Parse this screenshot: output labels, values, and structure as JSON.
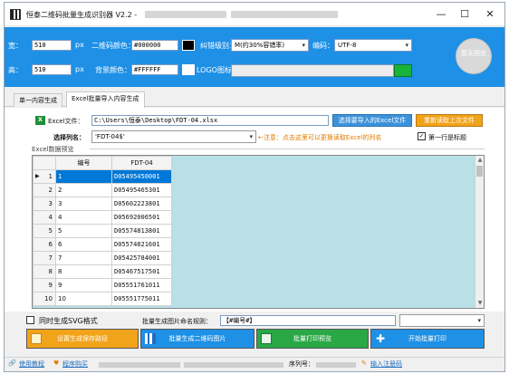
{
  "window": {
    "title": "恒泰二维码批量生成识别器 V2.2 - ",
    "controls": {
      "minimize": "—",
      "maximize": "☐",
      "close": "✕"
    }
  },
  "settings": {
    "width_label": "宽：",
    "width_value": "510",
    "width_unit": "px",
    "height_label": "高：",
    "height_value": "510",
    "height_unit": "px",
    "qr_color_label": "二维码颜色：",
    "qr_color_value": "#000000",
    "qr_color_hex": "#000000",
    "bg_color_label": "背景颜色：",
    "bg_color_value": "#FFFFFF",
    "bg_color_hex": "#FFFFFF",
    "error_level_label": "纠错级别：",
    "error_level_value": "M(约30%容错率)",
    "encoding_label": "编码：",
    "encoding_value": "UTF-8",
    "logo_label": "LOGO图标：",
    "preview_text": "暂无预览"
  },
  "tabs": [
    {
      "label": "单一内容生成",
      "active": false
    },
    {
      "label": "Excel批量导入内容生成",
      "active": true
    }
  ],
  "excel": {
    "file_label": "Excel文件：",
    "file_path": "C:\\Users\\恒泰\\Desktop\\FDT-04.xlsx",
    "select_button": "选择要导入的Excel文件",
    "reread_button": "重新读取上次文件",
    "column_label": "选择列名：",
    "column_value": "'FDT-04$'",
    "notice": "←注意：点击这里可以更换读取Excel的列名",
    "first_row_checked": true,
    "first_row_label": "第一行是标题",
    "preview_label": "Excel数据预览"
  },
  "grid": {
    "headers": [
      "编号",
      "FDT-04"
    ],
    "rows": [
      {
        "n": "1",
        "no": "1",
        "code": "D05495450001",
        "selected": true,
        "current": true
      },
      {
        "n": "2",
        "no": "2",
        "code": "D05495465301"
      },
      {
        "n": "3",
        "no": "3",
        "code": "D05602223801"
      },
      {
        "n": "4",
        "no": "4",
        "code": "D05692006501"
      },
      {
        "n": "5",
        "no": "5",
        "code": "D05574813801"
      },
      {
        "n": "6",
        "no": "6",
        "code": "D05574821601"
      },
      {
        "n": "7",
        "no": "7",
        "code": "D05425784001"
      },
      {
        "n": "8",
        "no": "8",
        "code": "D05467517501"
      },
      {
        "n": "9",
        "no": "9",
        "code": "D05551761011"
      },
      {
        "n": "10",
        "no": "10",
        "code": "D05551775011"
      }
    ]
  },
  "options": {
    "svg_checked": false,
    "svg_label": "同时生成SVG格式",
    "naming_label": "批量生成图片命名规则：",
    "naming_value": "【#编号#】"
  },
  "actions": [
    {
      "label": "设置生成保存路径",
      "color": "#f1a31a"
    },
    {
      "label": "批量生成二维码图片",
      "color": "#1e90e6"
    },
    {
      "label": "批量打印预览",
      "color": "#2aa845"
    },
    {
      "label": "开始批量打印",
      "color": "#1e90e6"
    }
  ],
  "status": {
    "help": "使用教程",
    "website": "程序购买",
    "serial_label": "序列号：",
    "register": "输入注册码"
  }
}
